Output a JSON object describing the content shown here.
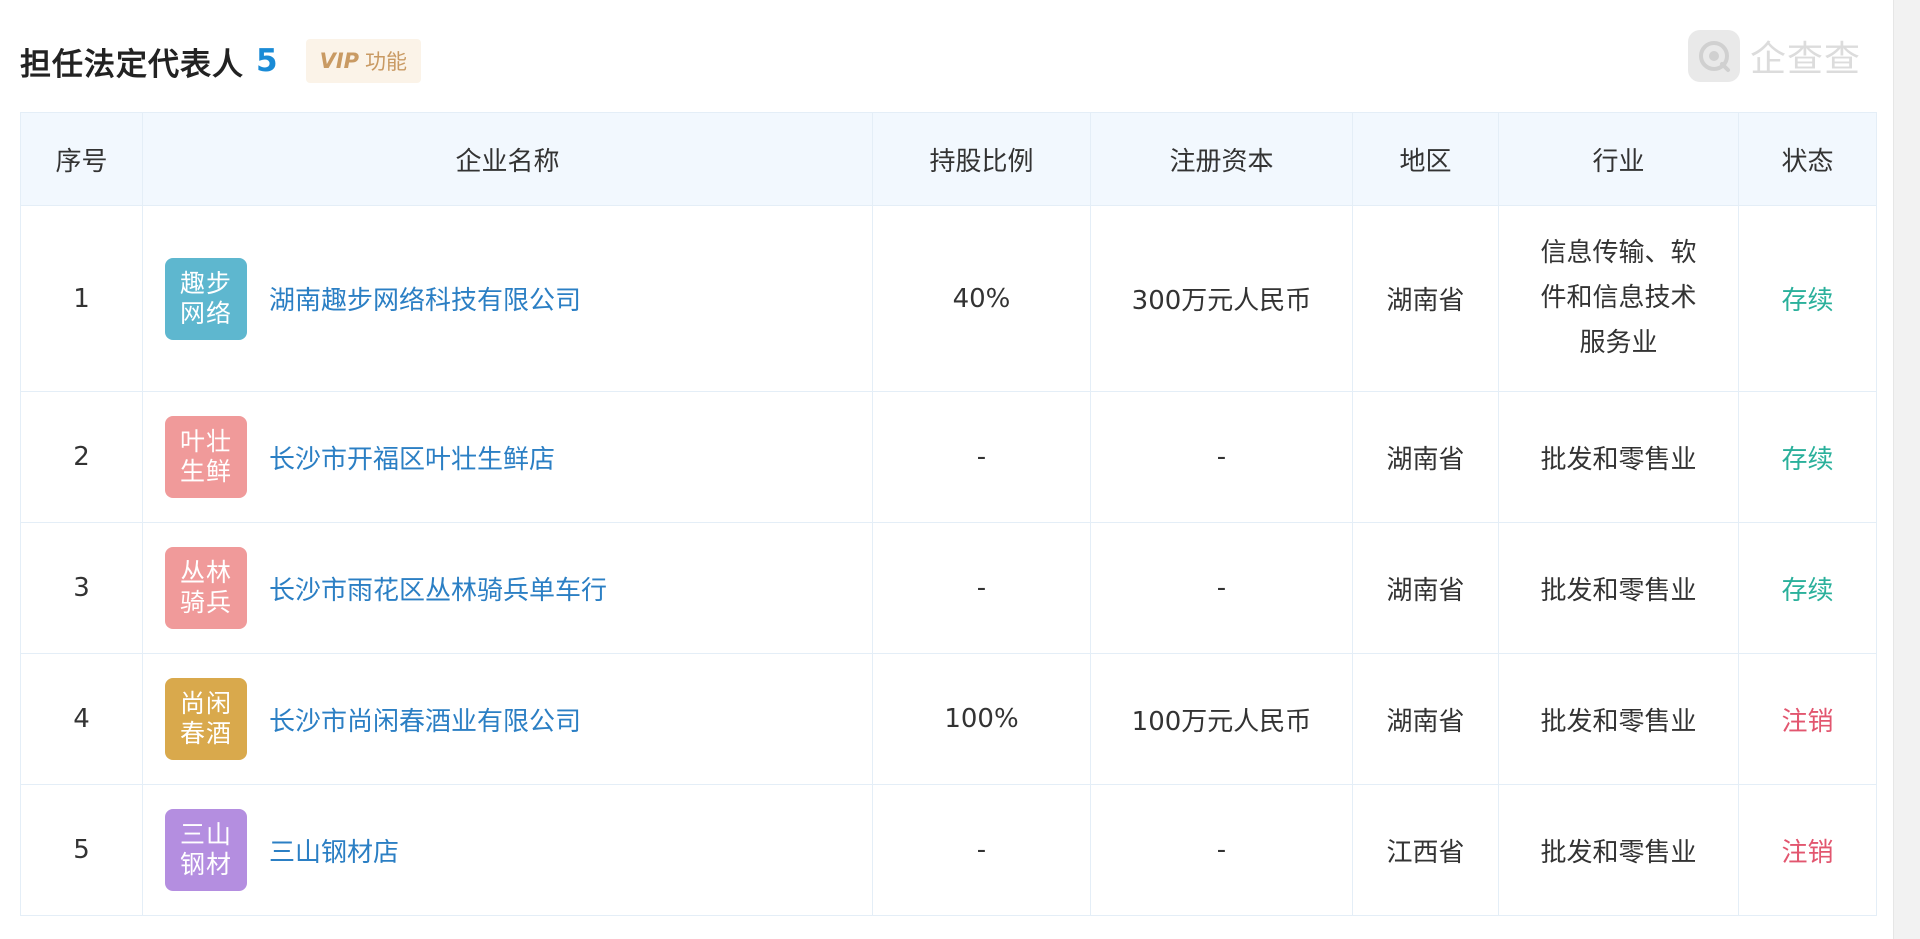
{
  "header": {
    "title": "担任法定代表人",
    "count": "5",
    "vip_label": "VIP",
    "vip_text": "功能"
  },
  "watermark": {
    "text": "企查查"
  },
  "table": {
    "columns": [
      "序号",
      "企业名称",
      "持股比例",
      "注册资本",
      "地区",
      "行业",
      "状态"
    ],
    "rows": [
      {
        "index": "1",
        "logo_text": "趣步网络",
        "logo_color": "#5eb7cf",
        "name": "湖南趣步网络科技有限公司",
        "share": "40%",
        "capital": "300万元人民币",
        "region": "湖南省",
        "industry": "信息传输、软件和信息技术服务业",
        "status": "存续",
        "status_color": "#2ab09b"
      },
      {
        "index": "2",
        "logo_text": "叶壮生鲜",
        "logo_color": "#f09a9a",
        "name": "长沙市开福区叶壮生鲜店",
        "share": "-",
        "capital": "-",
        "region": "湖南省",
        "industry": "批发和零售业",
        "status": "存续",
        "status_color": "#2ab09b"
      },
      {
        "index": "3",
        "logo_text": "丛林骑兵",
        "logo_color": "#f09a9a",
        "name": "长沙市雨花区丛林骑兵单车行",
        "share": "-",
        "capital": "-",
        "region": "湖南省",
        "industry": "批发和零售业",
        "status": "存续",
        "status_color": "#2ab09b"
      },
      {
        "index": "4",
        "logo_text": "尚闲春酒",
        "logo_color": "#d9a94c",
        "name": "长沙市尚闲春酒业有限公司",
        "share": "100%",
        "capital": "100万元人民币",
        "region": "湖南省",
        "industry": "批发和零售业",
        "status": "注销",
        "status_color": "#e2566f"
      },
      {
        "index": "5",
        "logo_text": "三山钢材",
        "logo_color": "#b48ee0",
        "name": "三山钢材店",
        "share": "-",
        "capital": "-",
        "region": "江西省",
        "industry": "批发和零售业",
        "status": "注销",
        "status_color": "#e2566f"
      }
    ]
  }
}
